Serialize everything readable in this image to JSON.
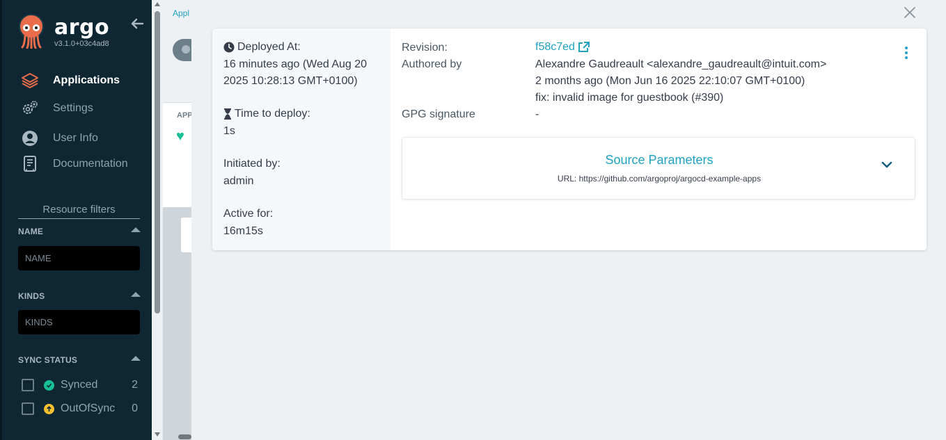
{
  "sidebar": {
    "logo_text": "argo",
    "version": "v3.1.0+03c4ad8",
    "nav": [
      {
        "label": "Applications",
        "icon": "layers-icon",
        "active": true
      },
      {
        "label": "Settings",
        "icon": "gears-icon",
        "active": false
      },
      {
        "label": "User Info",
        "icon": "user-circle-icon",
        "active": false
      },
      {
        "label": "Documentation",
        "icon": "book-icon",
        "active": false
      }
    ],
    "resource_filters": {
      "title": "Resource filters",
      "name": {
        "label": "NAME",
        "placeholder": "NAME"
      },
      "kinds": {
        "label": "KINDS",
        "placeholder": "KINDS"
      },
      "sync_status": {
        "label": "SYNC STATUS",
        "items": [
          {
            "label": "Synced",
            "count": "2",
            "color": "#18be94"
          },
          {
            "label": "OutOfSync",
            "count": "0",
            "color": "#f4c030"
          }
        ]
      }
    }
  },
  "background": {
    "breadcrumb": "Appl",
    "app_label": "APP"
  },
  "details": {
    "deployed_at": {
      "label": "Deployed At:",
      "value": "16 minutes ago (Wed Aug 20 2025 10:28:13 GMT+0100)"
    },
    "time_to_deploy": {
      "label": "Time to deploy:",
      "value": "1s"
    },
    "initiated_by": {
      "label": "Initiated by:",
      "value": "admin"
    },
    "active_for": {
      "label": "Active for:",
      "value": "16m15s"
    },
    "revision": {
      "label": "Revision:",
      "value": "f58c7ed"
    },
    "authored_by": {
      "label": "Authored by",
      "author": "Alexandre Gaudreault <alexandre_gaudreault@intuit.com>",
      "date": "2 months ago (Mon Jun 16 2025 22:10:07 GMT+0100)",
      "message": "fix: invalid image for guestbook (#390)"
    },
    "gpg": {
      "label": "GPG signature",
      "value": "-"
    },
    "source": {
      "title": "Source Parameters",
      "url": "URL: https://github.com/argoproj/argocd-example-apps"
    }
  },
  "colors": {
    "accent": "#20a1c2",
    "sidebar_bg": "#0f2733",
    "healthy": "#18be94"
  }
}
